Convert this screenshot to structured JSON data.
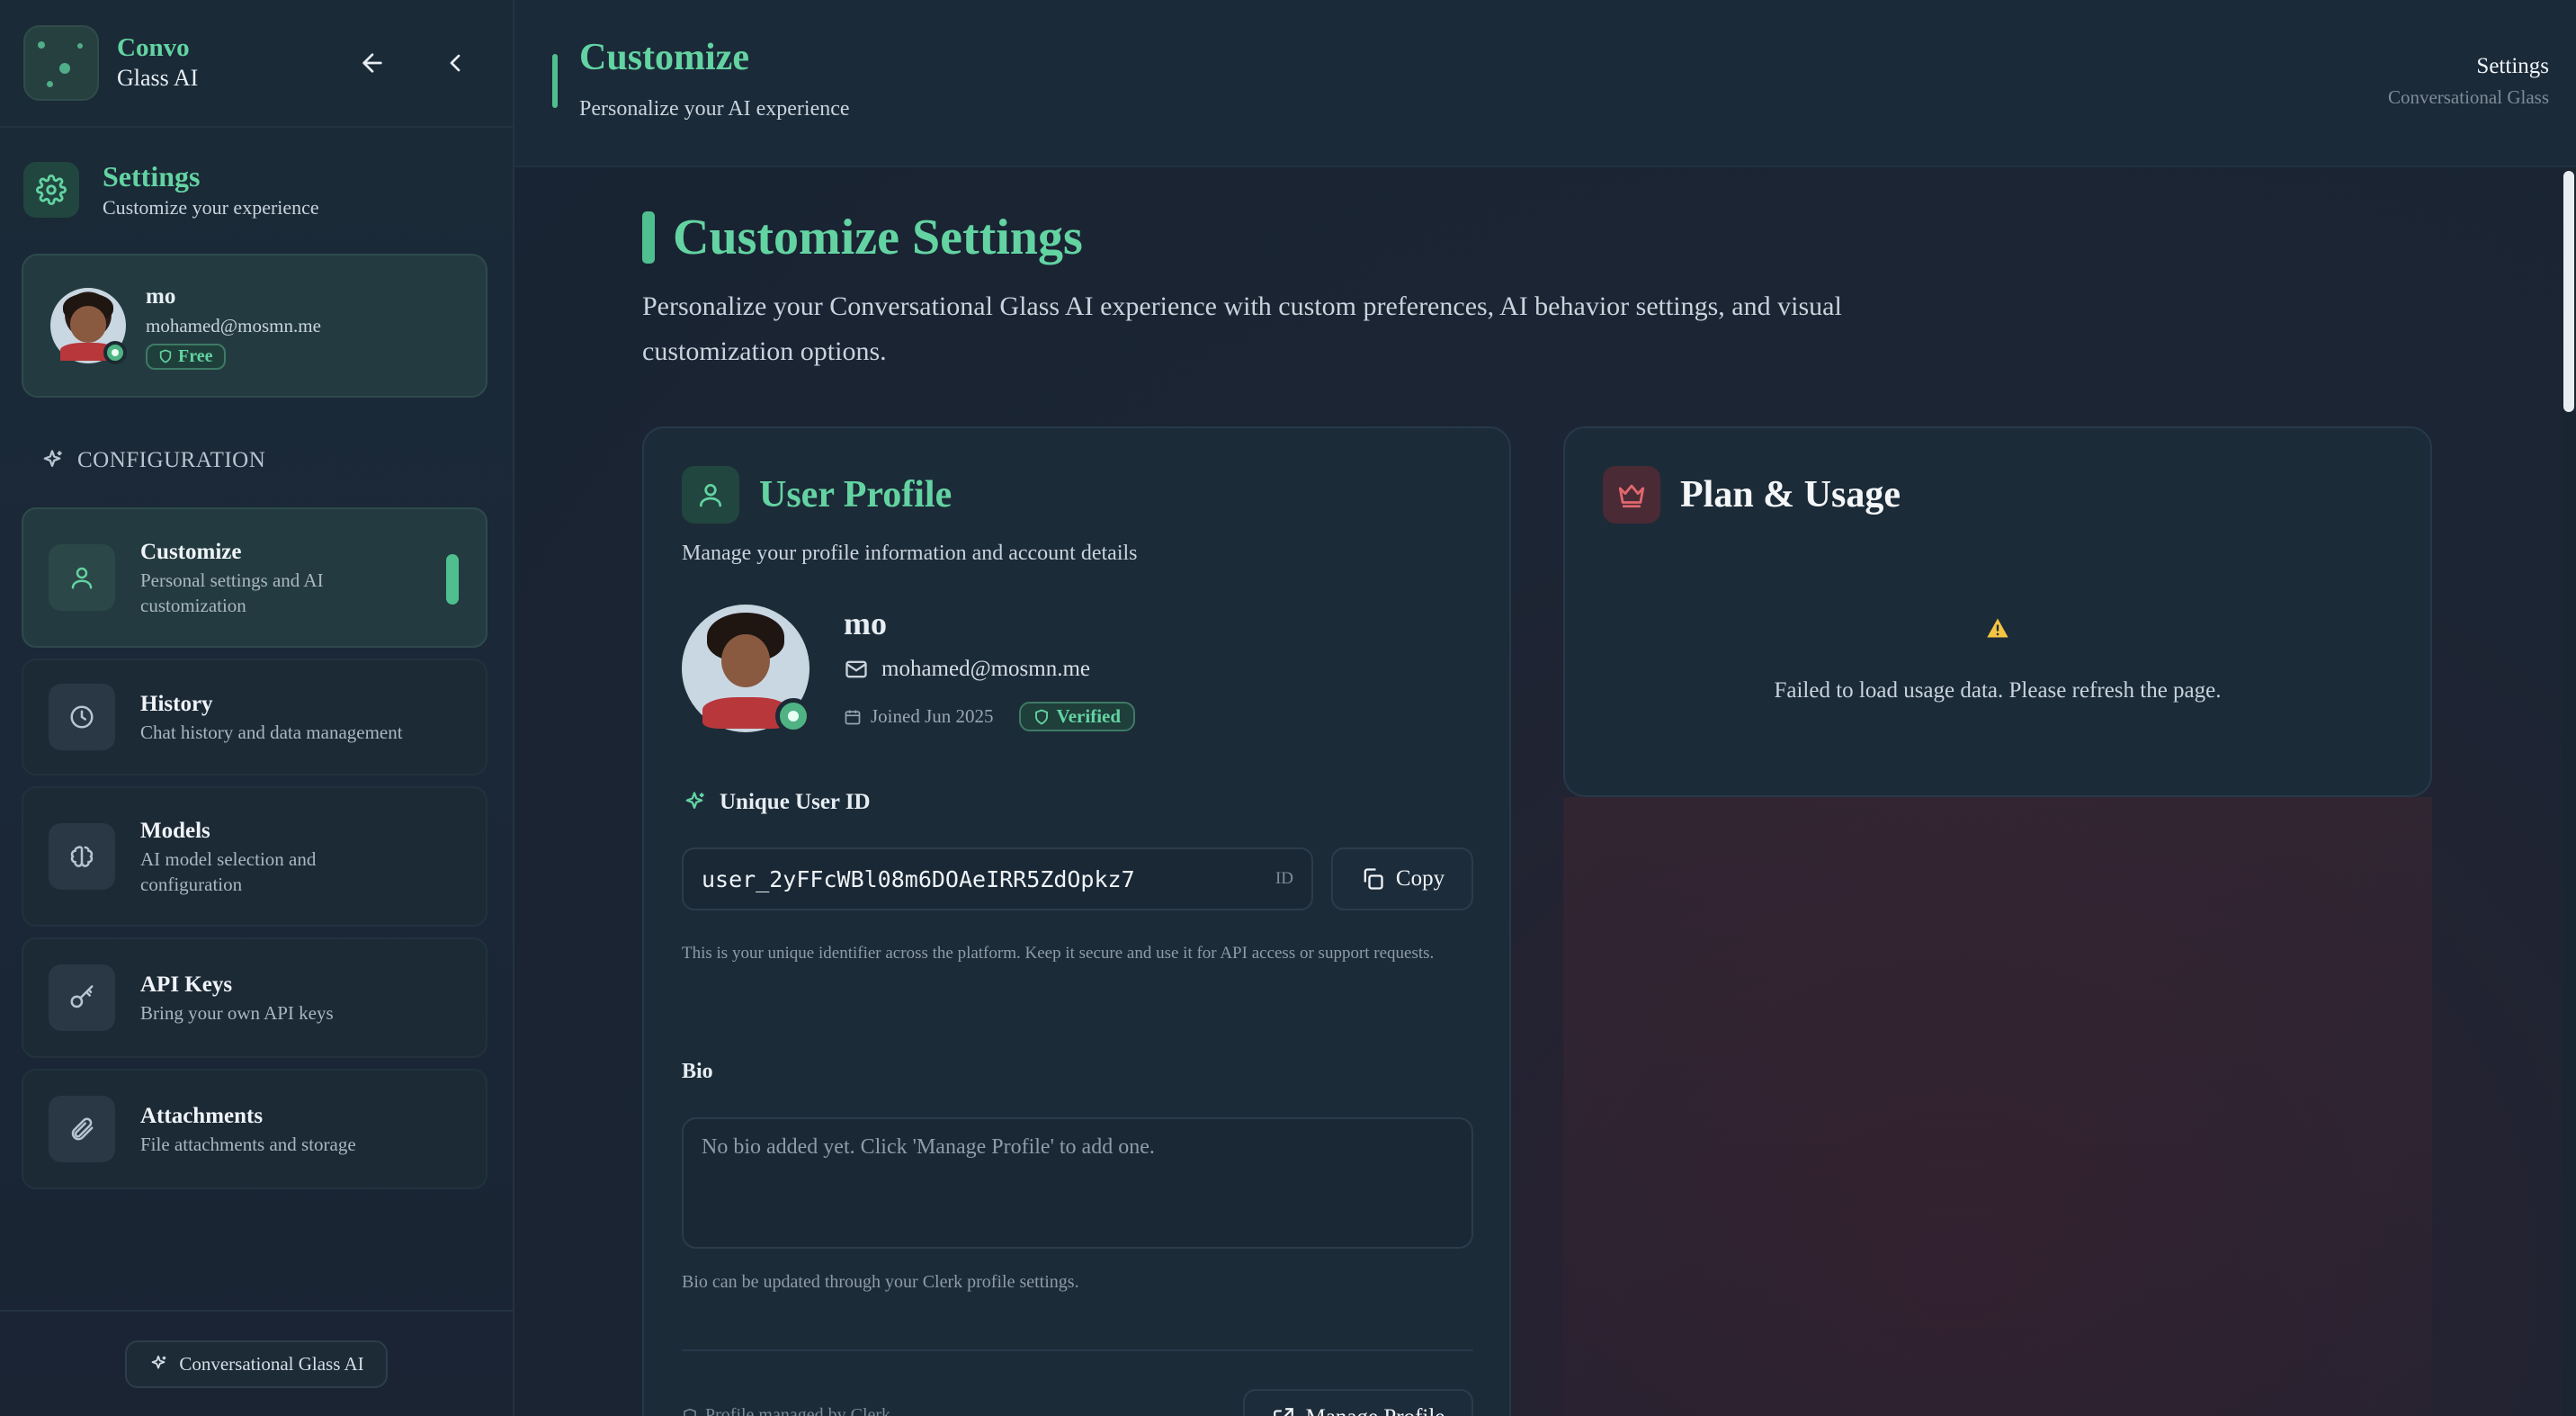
{
  "brand": {
    "name_line1": "Convo",
    "name_line2": "Glass AI"
  },
  "sidebar": {
    "settings_title": "Settings",
    "settings_subtitle": "Customize your experience",
    "user": {
      "name": "mo",
      "email": "mohamed@mosmn.me",
      "plan": "Free"
    },
    "section_label": "CONFIGURATION",
    "items": [
      {
        "label": "Customize",
        "desc": "Personal settings and AI customization",
        "icon": "user-icon",
        "active": true
      },
      {
        "label": "History",
        "desc": "Chat history and data management",
        "icon": "clock-icon",
        "active": false
      },
      {
        "label": "Models",
        "desc": "AI model selection and configuration",
        "icon": "brain-icon",
        "active": false
      },
      {
        "label": "API Keys",
        "desc": "Bring your own API keys",
        "icon": "key-icon",
        "active": false
      },
      {
        "label": "Attachments",
        "desc": "File attachments and storage",
        "icon": "paperclip-icon",
        "active": false
      }
    ],
    "footer_label": "Conversational Glass AI"
  },
  "header": {
    "title": "Customize",
    "subtitle": "Personalize your AI experience",
    "right_title": "Settings",
    "right_subtitle": "Conversational Glass"
  },
  "main": {
    "title": "Customize Settings",
    "description": "Personalize your Conversational Glass AI experience with custom preferences, AI behavior settings, and visual customization options."
  },
  "profile": {
    "title": "User Profile",
    "subtitle": "Manage your profile information and account details",
    "name": "mo",
    "email": "mohamed@mosmn.me",
    "joined": "Joined Jun 2025",
    "verified": "Verified",
    "uid_heading": "Unique User ID",
    "uid_value": "user_2yFFcWBl08m6DOAeIRR5ZdOpkz7",
    "uid_tag": "ID",
    "copy_label": "Copy",
    "uid_help": "This is your unique identifier across the platform. Keep it secure and use it for API access or support requests.",
    "bio_heading": "Bio",
    "bio_placeholder": "No bio added yet. Click 'Manage Profile' to add one.",
    "bio_help": "Bio can be updated through your Clerk profile settings.",
    "managed_by": "Profile managed by Clerk",
    "manage_button": "Manage Profile"
  },
  "plan": {
    "title": "Plan & Usage",
    "error": "Failed to load usage data. Please refresh the page."
  },
  "colors": {
    "accent": "#63d3a2",
    "accent_bar": "#4fbf8f",
    "warning": "#f5c542",
    "plan_icon": "#e0676f"
  }
}
